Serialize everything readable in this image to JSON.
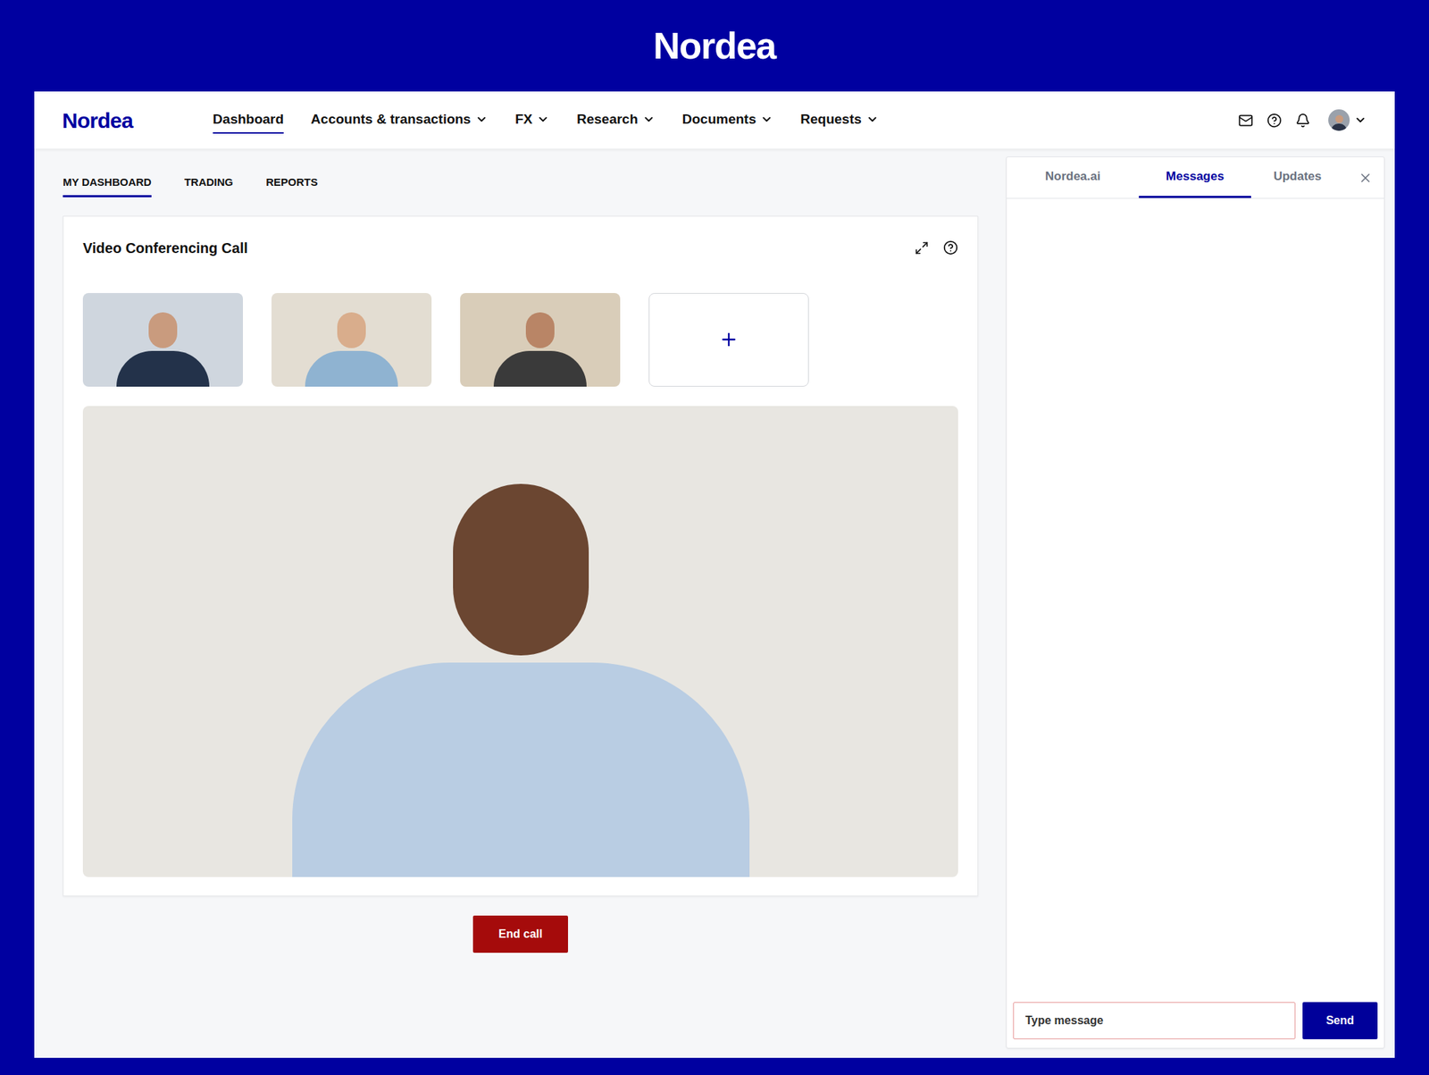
{
  "brand": {
    "banner_logo": "Nordea",
    "nav_logo": "Nordea"
  },
  "nav": {
    "items": [
      {
        "label": "Dashboard",
        "selected": true,
        "dropdown": false
      },
      {
        "label": "Accounts & transactions",
        "selected": false,
        "dropdown": true
      },
      {
        "label": "FX",
        "selected": false,
        "dropdown": true
      },
      {
        "label": "Research",
        "selected": false,
        "dropdown": true
      },
      {
        "label": "Documents",
        "selected": false,
        "dropdown": true
      },
      {
        "label": "Requests",
        "selected": false,
        "dropdown": true
      }
    ]
  },
  "subtabs": [
    {
      "label": "MY DASHBOARD",
      "selected": true
    },
    {
      "label": "TRADING",
      "selected": false
    },
    {
      "label": "REPORTS",
      "selected": false
    }
  ],
  "video_card": {
    "title": "Video Conferencing Call"
  },
  "end_call": "End call",
  "side_panel": {
    "tabs": [
      {
        "label": "Nordea.ai",
        "selected": false
      },
      {
        "label": "Messages",
        "selected": true
      },
      {
        "label": "Updates",
        "selected": false
      }
    ],
    "input": {
      "placeholder": "Type message"
    },
    "send": "Send"
  }
}
